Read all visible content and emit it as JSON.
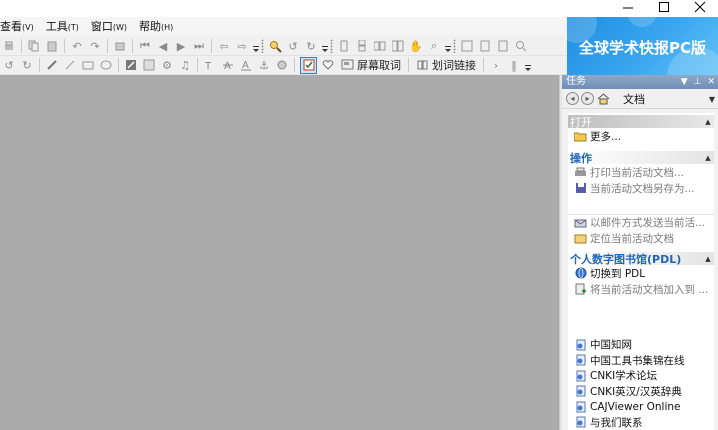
{
  "window": {
    "controls": [
      "minimize",
      "maximize",
      "close"
    ]
  },
  "menu": [
    {
      "label": "查看",
      "accel": "(V)"
    },
    {
      "label": "工具",
      "accel": "(T)"
    },
    {
      "label": "窗口",
      "accel": "(W)"
    },
    {
      "label": "帮助",
      "accel": "(H)"
    }
  ],
  "toolbar2": {
    "screen_capture_label": "屏幕取词",
    "word_link_label": "划词链接"
  },
  "banner": {
    "text": "全球学术快报PC版"
  },
  "taskpane": {
    "header": "任务",
    "nav_title": "文档",
    "open_section": {
      "title": "打开",
      "more": "更多..."
    },
    "ops_section": {
      "title": "操作",
      "items": [
        "打印当前活动文档...",
        "当前活动文档另存为..."
      ],
      "items2": [
        "以邮件方式发送当前活...",
        "定位当前活动文档"
      ]
    },
    "pdl_section": {
      "title": "个人数字图书馆(PDL)",
      "items": [
        "切换到 PDL",
        "将当前活动文档加入到 ..."
      ]
    },
    "links": [
      "中国知网",
      "中国工具书集锦在线",
      "CNKI学术论坛",
      "CNKI英汉/汉英辞典",
      "CAJViewer Online",
      "与我们联系"
    ]
  },
  "colors": {
    "doc_bg": "#ababab",
    "accent": "#1f66b8",
    "banner": "#2a9be8"
  }
}
